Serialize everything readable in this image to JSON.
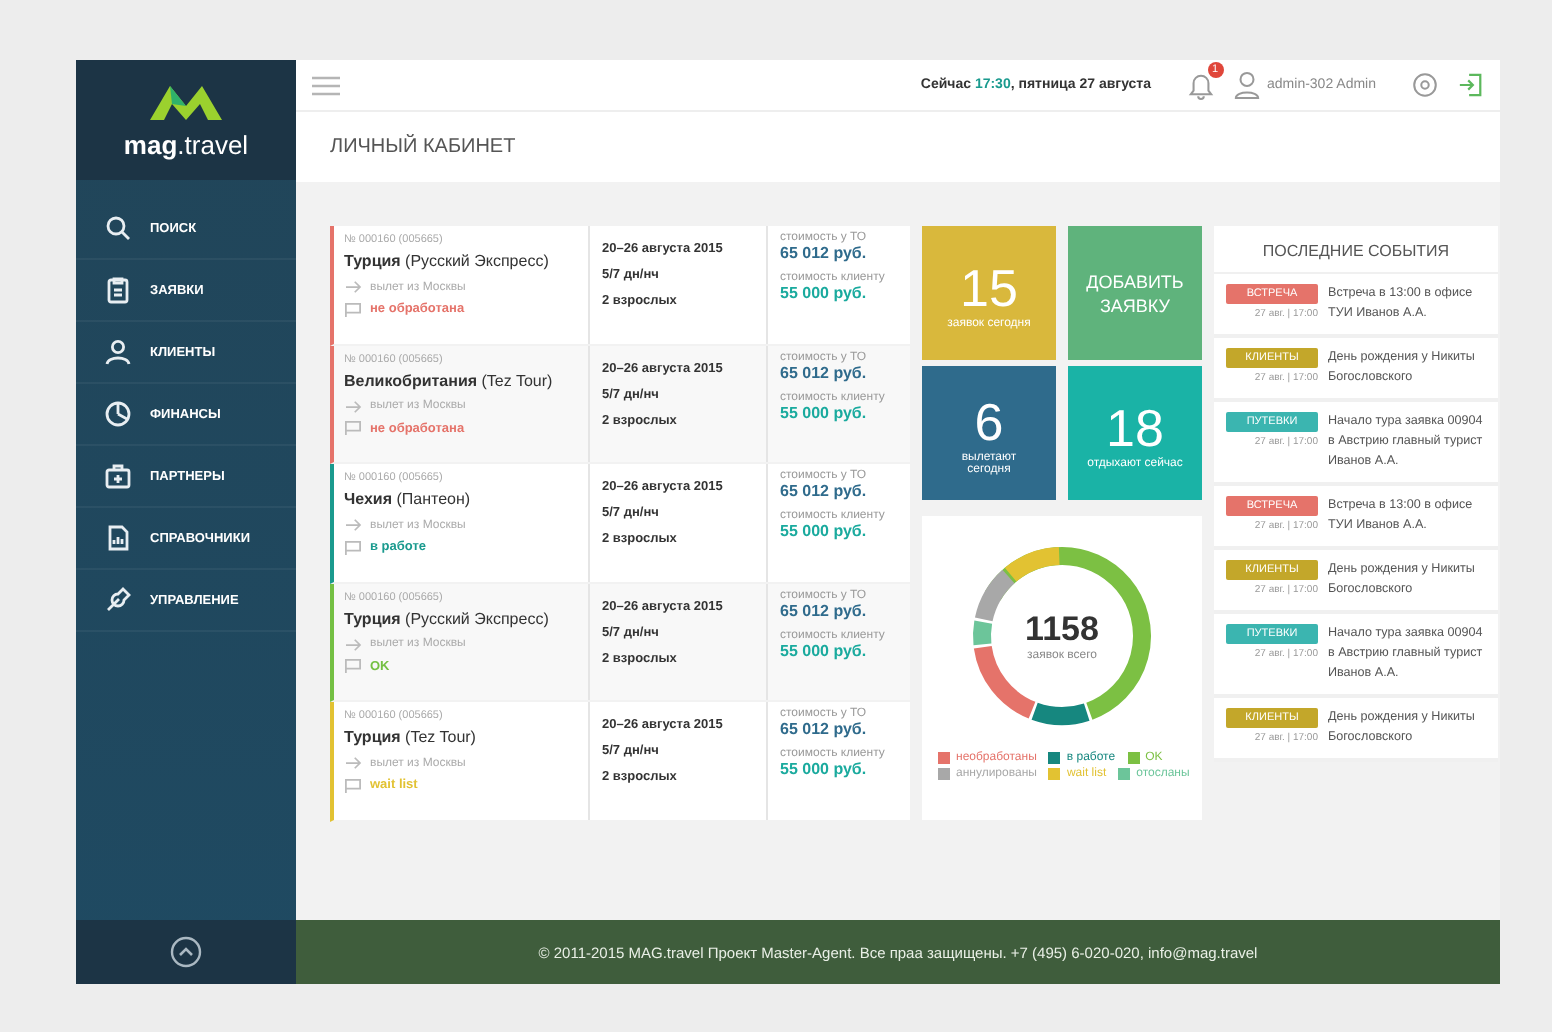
{
  "brand": {
    "name": "mag",
    "suffix": ".travel"
  },
  "sidebar": {
    "items": [
      {
        "label": "ПОИСК",
        "selected": false
      },
      {
        "label": "ЗАЯВКИ",
        "selected": false
      },
      {
        "label": "КЛИЕНТЫ",
        "selected": false
      },
      {
        "label": "ФИНАНСЫ",
        "selected": false
      },
      {
        "label": "ПАРТНЕРЫ",
        "selected": false
      },
      {
        "label": "СПРАВОЧНИКИ",
        "selected": false
      },
      {
        "label": "УПРАВЛЕНИЕ",
        "selected": false
      }
    ]
  },
  "header": {
    "now_label": "Сейчас",
    "time": "17:30",
    "date": ", пятница 27 августа",
    "notifications": "1",
    "user": "admin-302 Admin"
  },
  "page_title": "ЛИЧНЫЙ КАБИНЕТ",
  "orders": [
    {
      "number": "№ 000160  (005665)",
      "country": "Турция",
      "operator": "(Русский Экспресс)",
      "departure": "вылет из Москвы",
      "status": "не обработана",
      "color": "#e5736a",
      "dates": "20–26 августа 2015",
      "nights": "5/7 дн/нч",
      "people": "2 взрослых",
      "cost_label": "стоимость у ТО",
      "cost": "65 012 руб.",
      "client_label": "стоимость клиенту",
      "client_price": "55 000 руб."
    },
    {
      "number": "№ 000160  (005665)",
      "country": "Великобритания",
      "operator": "(Tez Tour)",
      "departure": "вылет из Москвы",
      "status": "не обработана",
      "color": "#e5736a",
      "dates": "20–26 августа 2015",
      "nights": "5/7 дн/нч",
      "people": "2 взрослых",
      "cost_label": "стоимость у ТО",
      "cost": "65 012 руб.",
      "client_label": "стоимость клиенту",
      "client_price": "55 000 руб."
    },
    {
      "number": "№ 000160  (005665)",
      "country": "Чехия",
      "operator": "(Пантеон)",
      "departure": "вылет из Москвы",
      "status": "в работе",
      "color": "#1a9a8e",
      "dates": "20–26 августа 2015",
      "nights": "5/7 дн/нч",
      "people": "2 взрослых",
      "cost_label": "стоимость у ТО",
      "cost": "65 012 руб.",
      "client_label": "стоимость клиенту",
      "client_price": "55 000 руб."
    },
    {
      "number": "№ 000160  (005665)",
      "country": "Турция",
      "operator": "(Русский Экспресс)",
      "departure": "вылет из Москвы",
      "status": "OK",
      "color": "#74c043",
      "dates": "20–26 августа 2015",
      "nights": "5/7 дн/нч",
      "people": "2 взрослых",
      "cost_label": "стоимость у ТО",
      "cost": "65 012 руб.",
      "client_label": "стоимость клиенту",
      "client_price": "55 000 руб."
    },
    {
      "number": "№ 000160  (005665)",
      "country": "Турция",
      "operator": "(Tez Tour)",
      "departure": "вылет из Москвы",
      "status": "wait list",
      "color": "#e2c232",
      "dates": "20–26 августа 2015",
      "nights": "5/7 дн/нч",
      "people": "2 взрослых",
      "cost_label": "стоимость у ТО",
      "cost": "65 012 руб.",
      "client_label": "стоимость клиенту",
      "client_price": "55 000 руб."
    }
  ],
  "tiles": [
    {
      "kind": "counter",
      "value": "15",
      "label": "заявок сегодня",
      "color": "#d9b83c"
    },
    {
      "kind": "action",
      "label": "ДОБАВИТЬ ЗАЯВКУ",
      "color": "#5fb37c"
    },
    {
      "kind": "counter",
      "value": "6",
      "label": "вылетают сегодня",
      "color": "#2f6b8c"
    },
    {
      "kind": "counter",
      "value": "18",
      "label": "отдыхают сейчас",
      "color": "#1ab3a6"
    }
  ],
  "summary": {
    "total": "1158",
    "total_label": "заявок всего",
    "legend": [
      {
        "label": "необработаны",
        "color": "#e5736a"
      },
      {
        "label": "в работе",
        "color": "#16877f"
      },
      {
        "label": "OK",
        "color": "#7cc043"
      },
      {
        "label": "аннулированы",
        "color": "#a8a8a8"
      },
      {
        "label": "wait list",
        "color": "#e2c232"
      },
      {
        "label": "отосланы",
        "color": "#6cc59a"
      }
    ]
  },
  "events": {
    "title": "ПОСЛЕДНИЕ СОБЫТИЯ",
    "items": [
      {
        "tag": "ВСТРЕЧА",
        "color": "#e5736a",
        "time": "27 авг. | 17:00",
        "text": "Встреча в 13:00 в офисе ТУИ Иванов А.А."
      },
      {
        "tag": "КЛИЕНТЫ",
        "color": "#c3a72a",
        "time": "27 авг. | 17:00",
        "text": "День рождения у Никиты Богословского"
      },
      {
        "tag": "ПУТЕВКИ",
        "color": "#3bb5b0",
        "time": "27 авг. | 17:00",
        "text": "Начало тура заявка 00904 в Австрию главный турист Иванов А.А."
      },
      {
        "tag": "ВСТРЕЧА",
        "color": "#e5736a",
        "time": "27 авг. | 17:00",
        "text": "Встреча в 13:00 в офисе ТУИ Иванов А.А."
      },
      {
        "tag": "КЛИЕНТЫ",
        "color": "#c3a72a",
        "time": "27 авг. | 17:00",
        "text": "День рождения у Никиты Богословского"
      },
      {
        "tag": "ПУТЕВКИ",
        "color": "#3bb5b0",
        "time": "27 авг. | 17:00",
        "text": "Начало тура заявка 00904 в Австрию главный турист Иванов А.А."
      },
      {
        "tag": "КЛИЕНТЫ",
        "color": "#c3a72a",
        "time": "27 авг. | 17:00",
        "text": "День рождения у Никиты Богословского"
      }
    ]
  },
  "footer": "© 2011-2015 MAG.travel Проект Master-Agent. Все праа защищены. +7 (495) 6-020-020, info@mag.travel"
}
